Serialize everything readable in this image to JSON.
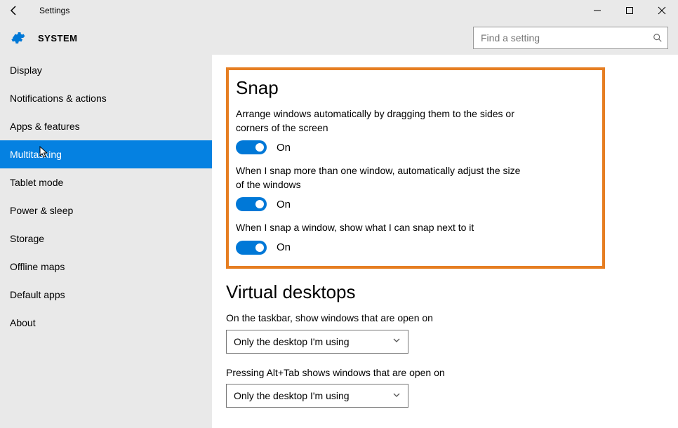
{
  "window": {
    "title": "Settings"
  },
  "header": {
    "section": "SYSTEM"
  },
  "search": {
    "placeholder": "Find a setting"
  },
  "sidebar": {
    "items": [
      {
        "label": "Display"
      },
      {
        "label": "Notifications & actions"
      },
      {
        "label": "Apps & features"
      },
      {
        "label": "Multitasking"
      },
      {
        "label": "Tablet mode"
      },
      {
        "label": "Power & sleep"
      },
      {
        "label": "Storage"
      },
      {
        "label": "Offline maps"
      },
      {
        "label": "Default apps"
      },
      {
        "label": "About"
      }
    ],
    "active_index": 3
  },
  "content": {
    "snap": {
      "heading": "Snap",
      "options": [
        {
          "desc": "Arrange windows automatically by dragging them to the sides or corners of the screen",
          "state": "On"
        },
        {
          "desc": "When I snap more than one window, automatically adjust the size of the windows",
          "state": "On"
        },
        {
          "desc": "When I snap a window, show what I can snap next to it",
          "state": "On"
        }
      ]
    },
    "virtual_desktops": {
      "heading": "Virtual desktops",
      "settings": [
        {
          "label": "On the taskbar, show windows that are open on",
          "value": "Only the desktop I'm using"
        },
        {
          "label": "Pressing Alt+Tab shows windows that are open on",
          "value": "Only the desktop I'm using"
        }
      ]
    }
  },
  "highlight": {
    "color": "#e67e22"
  },
  "colors": {
    "accent": "#0078d7",
    "sidebar_active": "#0581e1"
  }
}
